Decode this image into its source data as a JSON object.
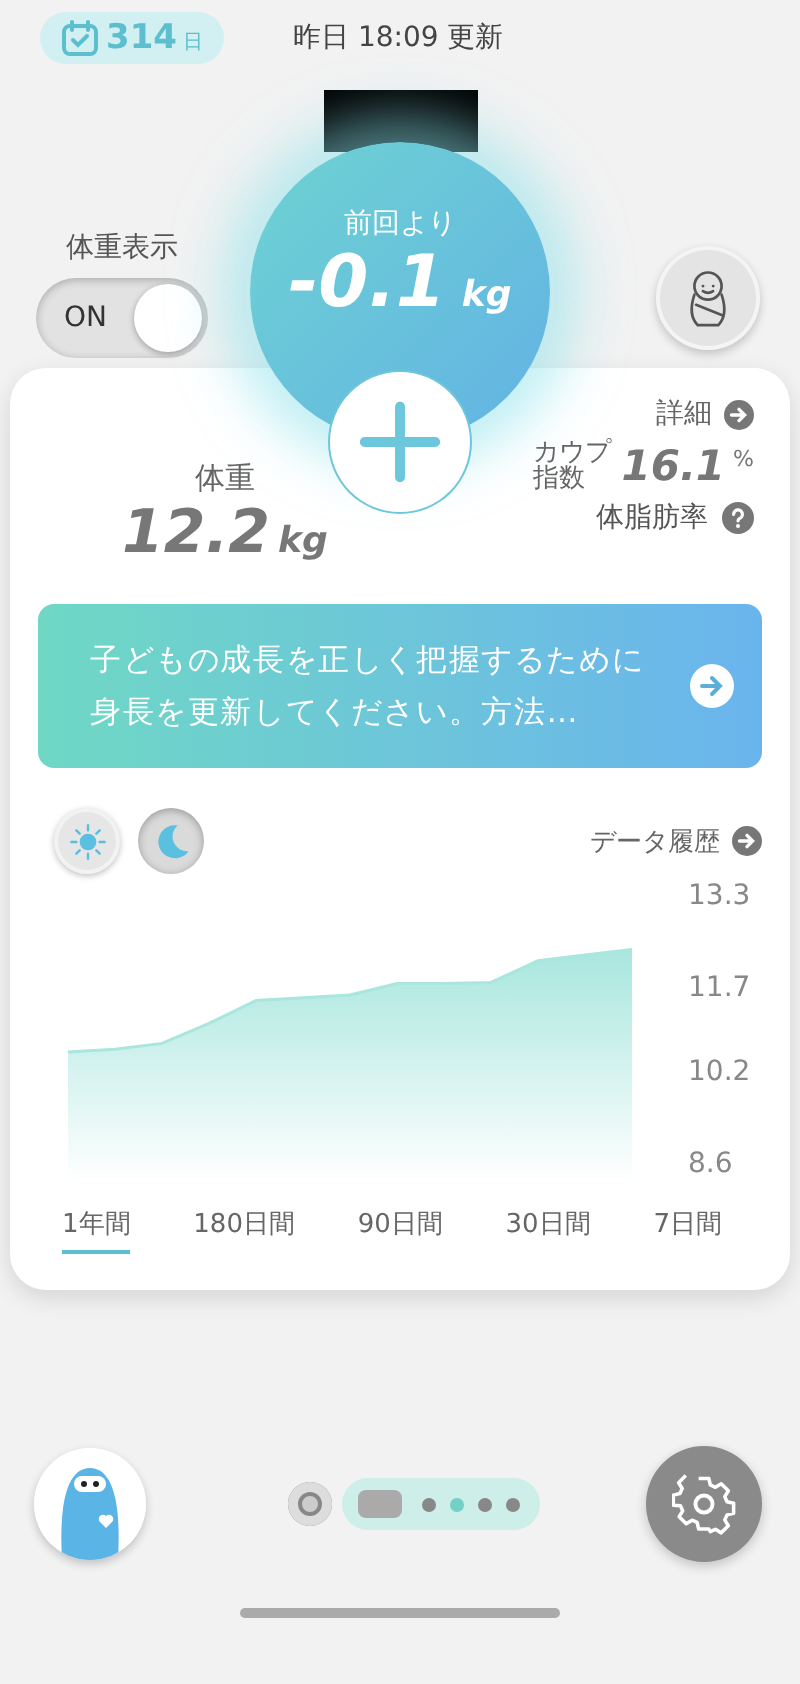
{
  "header": {
    "days": "314",
    "days_unit": "日",
    "updated": "昨日 18:09 更新"
  },
  "weight_display": {
    "label": "体重表示",
    "toggle_label": "ON",
    "on": true
  },
  "change": {
    "label": "前回より",
    "value": "-0.1",
    "unit": "kg"
  },
  "weight": {
    "label": "体重",
    "value": "12.2",
    "unit": "kg"
  },
  "details_link": "詳細",
  "kaup": {
    "label": "カウプ指数",
    "value": "16.1",
    "unit": "%"
  },
  "body_fat": {
    "label": "体脂肪率"
  },
  "banner": {
    "text": "子どもの成長を正しく把握するために身長を更新してください。方法…"
  },
  "time_of_day": [
    {
      "kind": "sun",
      "selected": false
    },
    {
      "kind": "moon",
      "selected": true
    }
  ],
  "history_link": "データ履歴",
  "chart_data": {
    "type": "area",
    "ylim": [
      8.6,
      13.3
    ],
    "yticks": [
      8.6,
      10.2,
      11.7,
      13.3
    ],
    "categories": [
      null,
      null,
      null,
      null,
      null,
      null,
      null,
      null,
      null,
      null,
      null,
      null,
      null
    ],
    "series": [
      {
        "color": "#a8e6de",
        "values": [
          10.6,
          10.65,
          10.75,
          11.1,
          11.5,
          11.55,
          11.6,
          11.8,
          11.8,
          11.82,
          12.2,
          12.3,
          12.4
        ]
      }
    ]
  },
  "periods": [
    {
      "label": "1年間",
      "selected": true
    },
    {
      "label": "180日間",
      "selected": false
    },
    {
      "label": "90日間",
      "selected": false
    },
    {
      "label": "30日間",
      "selected": false
    },
    {
      "label": "7日間",
      "selected": false
    }
  ],
  "page_dots": [
    {
      "selected": false
    },
    {
      "selected": true
    },
    {
      "selected": false
    },
    {
      "selected": false
    }
  ]
}
